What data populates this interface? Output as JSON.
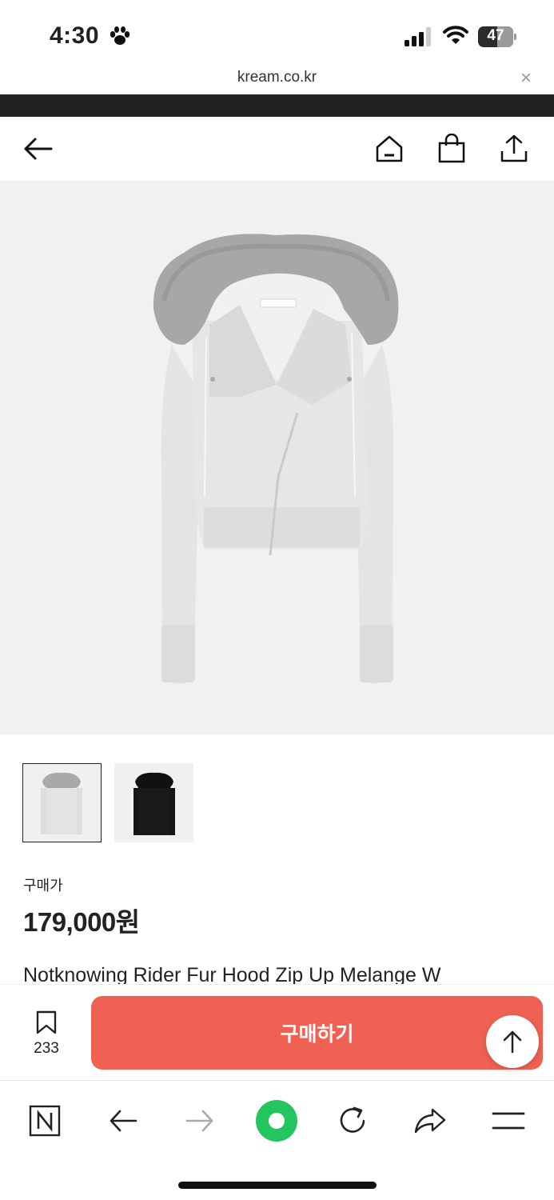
{
  "status_bar": {
    "time": "4:30",
    "battery": "47"
  },
  "browser": {
    "url": "kream.co.kr",
    "close_symbol": "×"
  },
  "header": {
    "icons": [
      "back-arrow-icon",
      "home-icon",
      "shopping-bag-icon",
      "share-icon"
    ]
  },
  "product": {
    "thumbnails": [
      "light gray hoodie",
      "black hoodie"
    ],
    "selected_thumbnail": 0,
    "price_label": "구매가",
    "price": "179,000원",
    "title": "Notknowing Rider Fur Hood Zip Up Melange W"
  },
  "buy_bar": {
    "bookmark_count": "233",
    "buy_label": "구매하기"
  },
  "colors": {
    "buy_button": "#ef6253",
    "browser_green": "#22c55e"
  }
}
